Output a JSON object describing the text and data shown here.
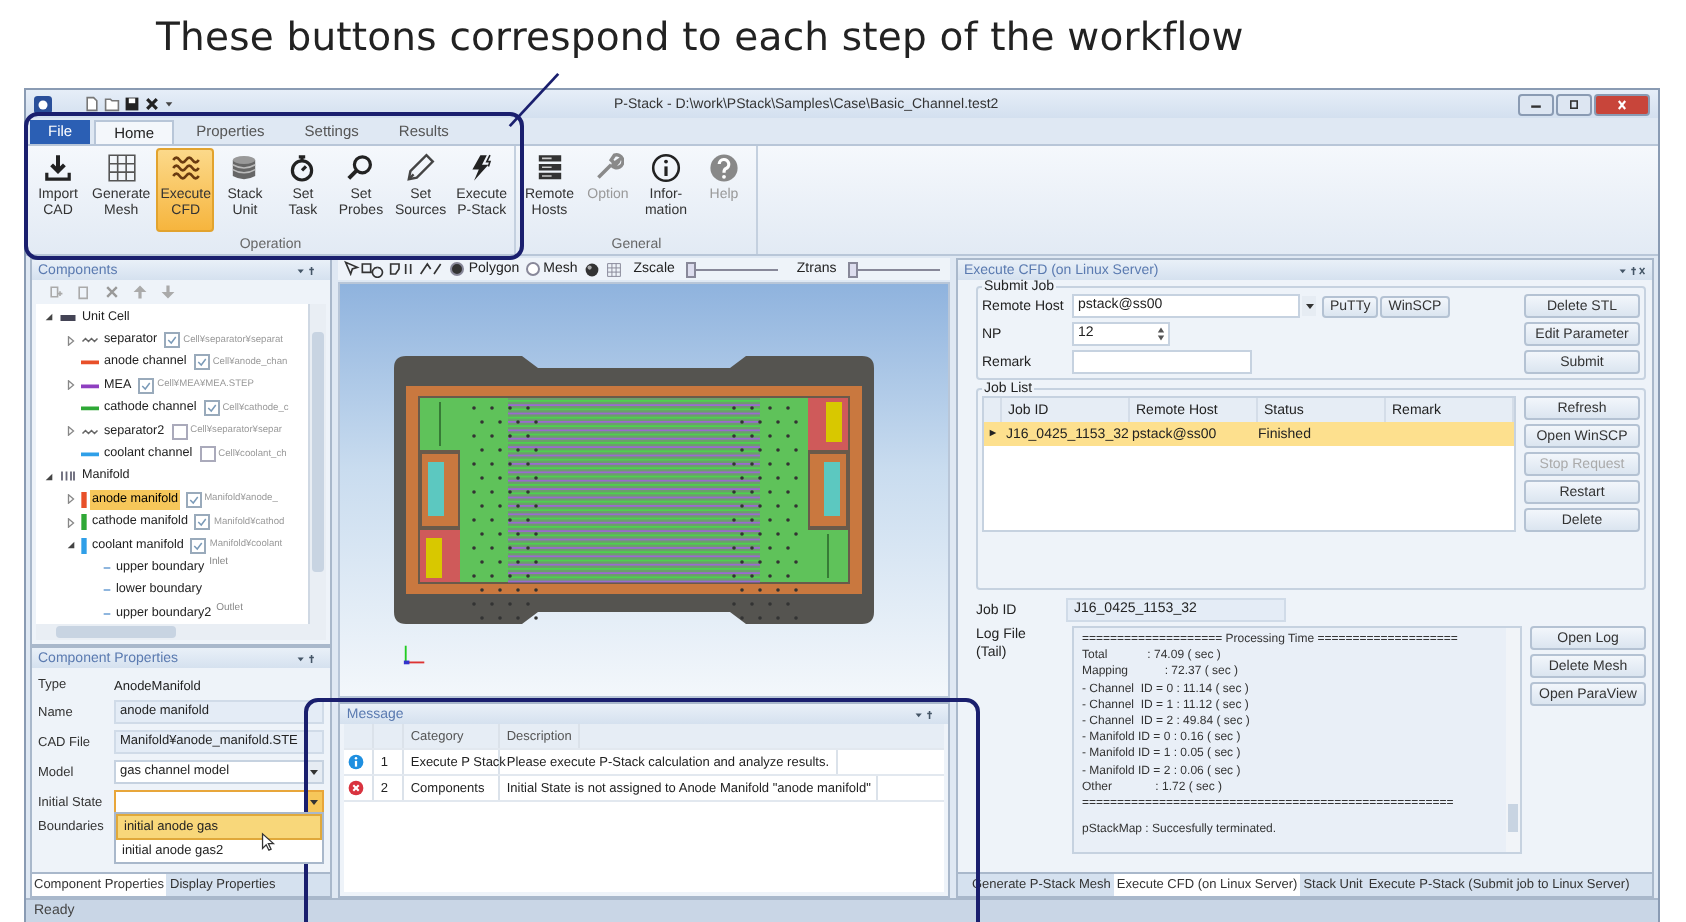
{
  "annotation": {
    "caption": "These buttons correspond to each step of the workflow"
  },
  "window": {
    "title": "P-Stack - D:\\work\\PStack\\Samples\\Case\\Basic_Channel.test2"
  },
  "ribbon": {
    "tabs": [
      {
        "label": "File",
        "kind": "file",
        "selected": false
      },
      {
        "label": "Home",
        "kind": "tab",
        "selected": true
      },
      {
        "label": "Properties",
        "kind": "tab",
        "selected": false
      },
      {
        "label": "Settings",
        "kind": "tab",
        "selected": false
      },
      {
        "label": "Results",
        "kind": "tab",
        "selected": false
      }
    ],
    "groups": [
      {
        "label": "Operation",
        "buttons": [
          {
            "label": "Import\nCAD",
            "kind": "import",
            "selected": false,
            "disabled": false
          },
          {
            "label": "Generate\nMesh",
            "kind": "grid",
            "selected": false,
            "disabled": false
          },
          {
            "label": "Execute\nCFD",
            "kind": "waves",
            "selected": true,
            "disabled": false
          },
          {
            "label": "Stack\nUnit",
            "kind": "stack",
            "selected": false,
            "disabled": false
          },
          {
            "label": "Set\nTask",
            "kind": "stopwatch",
            "selected": false,
            "disabled": false
          },
          {
            "label": "Set\nProbes",
            "kind": "magnifier",
            "selected": false,
            "disabled": false
          },
          {
            "label": "Set\nSources",
            "kind": "pen",
            "selected": false,
            "disabled": false
          },
          {
            "label": "Execute\nP-Stack",
            "kind": "lightning",
            "selected": false,
            "disabled": false
          }
        ]
      },
      {
        "label": "General",
        "buttons": [
          {
            "label": "Remote\nHosts",
            "kind": "server",
            "selected": false,
            "disabled": false
          },
          {
            "label": "Option",
            "kind": "wrench",
            "selected": false,
            "disabled": true
          },
          {
            "label": "Infor-\nmation",
            "kind": "info",
            "selected": false,
            "disabled": false
          },
          {
            "label": "Help",
            "kind": "help",
            "selected": false,
            "disabled": true
          }
        ]
      }
    ]
  },
  "components": {
    "title": "Components",
    "tree": [
      {
        "label": "Unit Cell",
        "kind": "cell-group",
        "expanded": true,
        "selected": false,
        "children": [
          {
            "label": "separator",
            "kind": "wave",
            "expanded": false,
            "checked": true,
            "file": "Cell¥separator¥separat",
            "selected": false
          },
          {
            "label": "anode channel",
            "kind": "line",
            "color": "#e8502a",
            "checked": true,
            "file": "Cell¥anode_chan",
            "selected": false
          },
          {
            "label": "MEA",
            "kind": "line",
            "color": "#8e3fc0",
            "expanded": false,
            "checked": true,
            "file": "Cell¥MEA¥MEA.STEP",
            "selected": false
          },
          {
            "label": "cathode channel",
            "kind": "line",
            "color": "#2fa836",
            "checked": true,
            "file": "Cell¥cathode_c",
            "selected": false
          },
          {
            "label": "separator2",
            "kind": "wave",
            "expanded": false,
            "checked": false,
            "file": "Cell¥separator¥separ",
            "selected": false
          },
          {
            "label": "coolant channel",
            "kind": "line",
            "color": "#2f9fe8",
            "checked": false,
            "file": "Cell¥coolant_ch",
            "selected": false
          }
        ]
      },
      {
        "label": "Manifold",
        "kind": "manifold-group",
        "expanded": true,
        "selected": false,
        "children": [
          {
            "label": "anode manifold",
            "kind": "bar",
            "color": "#e8502a",
            "expanded": false,
            "checked": true,
            "file": "Manifold¥anode_",
            "selected": true
          },
          {
            "label": "cathode manifold",
            "kind": "bar",
            "color": "#2fa836",
            "expanded": false,
            "checked": true,
            "file": "Manifold¥cathod",
            "selected": false
          },
          {
            "label": "coolant manifold",
            "kind": "bar",
            "color": "#2f9fe8",
            "expanded": true,
            "checked": true,
            "file": "Manifold¥coolant",
            "selected": false,
            "children": [
              {
                "label": "upper boundary",
                "kind": "boundary",
                "tag": "Inlet",
                "selected": false
              },
              {
                "label": "lower boundary",
                "kind": "boundary",
                "selected": false
              },
              {
                "label": "upper boundary2",
                "kind": "boundary",
                "tag": "Outlet",
                "selected": false
              }
            ]
          }
        ]
      }
    ]
  },
  "component_properties": {
    "title": "Component Properties",
    "fields": [
      {
        "label": "Type",
        "kind": "text",
        "value": "AnodeManifold"
      },
      {
        "label": "Name",
        "kind": "field",
        "value": "anode manifold"
      },
      {
        "label": "CAD File",
        "kind": "field",
        "value": "Manifold¥anode_manifold.STE"
      },
      {
        "label": "Model",
        "kind": "dropdown",
        "value": "gas channel model",
        "open": false
      },
      {
        "label": "Initial State",
        "kind": "dropdown",
        "open": true,
        "options": [
          {
            "label": "initial anode gas",
            "selected": true
          },
          {
            "label": "initial anode gas2",
            "selected": false
          }
        ]
      },
      {
        "label": "Boundaries",
        "kind": "text"
      }
    ],
    "tabs": [
      {
        "label": "Component Properties",
        "selected": true
      },
      {
        "label": "Display Properties",
        "selected": false
      }
    ]
  },
  "viewport": {
    "toolbar": {
      "modes": [
        {
          "label": "Polygon",
          "selected": true
        },
        {
          "label": "Mesh",
          "selected": false
        }
      ],
      "sliders": [
        {
          "label": "Zscale",
          "level": 0
        },
        {
          "label": "Ztrans",
          "level": 0
        }
      ]
    }
  },
  "messages": {
    "title": "Message",
    "columns": [
      "Category",
      "Description"
    ],
    "rows": [
      {
        "kind": "info",
        "number": "1",
        "category": "Execute P Stack",
        "description": "Please execute P-Stack calculation and analyze results."
      },
      {
        "kind": "error",
        "number": "2",
        "category": "Components",
        "description": "Initial State is not assigned to Anode Manifold \"anode manifold\""
      }
    ]
  },
  "cfd_panel": {
    "title": "Execute CFD (on Linux Server)",
    "submit_job": {
      "title": "Submit Job",
      "remote_host_label": "Remote Host",
      "remote_host": "pstack@ss00",
      "host_buttons": [
        "PuTTy",
        "WinSCP"
      ],
      "np_label": "NP",
      "np": "12",
      "remark_label": "Remark",
      "buttons": [
        {
          "label": "Delete STL",
          "disabled": false
        },
        {
          "label": "Edit Parameter",
          "disabled": false
        },
        {
          "label": "Submit",
          "disabled": false
        }
      ]
    },
    "job_list": {
      "title": "Job List",
      "columns": [
        "Job ID",
        "Remote Host",
        "Status",
        "Remark"
      ],
      "rows": [
        {
          "cells": [
            "J16_0425_1153_32",
            "pstack@ss00",
            "Finished"
          ],
          "selected": true
        }
      ],
      "buttons": [
        {
          "label": "Refresh",
          "disabled": false
        },
        {
          "label": "Open WinSCP",
          "disabled": false
        },
        {
          "label": "Stop Request",
          "disabled": true
        },
        {
          "label": "Restart",
          "disabled": false
        },
        {
          "label": "Delete",
          "disabled": false
        }
      ]
    },
    "job_id_label": "Job ID",
    "job_id": "J16_0425_1153_32",
    "log_label": "Log File\n(Tail)",
    "log_lines": [
      "==================== Processing Time ====================",
      "Total            : 74.09 ( sec )",
      "Mapping           : 72.37 ( sec )",
      "- Channel  ID = 0 : 11.14 ( sec )",
      "- Channel  ID = 1 : 11.12 ( sec )",
      "- Channel  ID = 2 : 49.84 ( sec )",
      "- Manifold ID = 0 : 0.16 ( sec )",
      "- Manifold ID = 1 : 0.05 ( sec )",
      "- Manifold ID = 2 : 0.06 ( sec )",
      "Other             : 1.72 ( sec )",
      "=====================================================",
      "pStackMap : Succesfully terminated."
    ],
    "log_buttons": [
      {
        "label": "Open Log",
        "disabled": false
      },
      {
        "label": "Delete Mesh",
        "disabled": false
      },
      {
        "label": "Open ParaView",
        "disabled": false
      }
    ]
  },
  "bottom_tabs": [
    {
      "label": "Generate P-Stack Mesh",
      "selected": false
    },
    {
      "label": "Execute CFD (on Linux Server)",
      "selected": true
    },
    {
      "label": "Stack Unit",
      "selected": false
    },
    {
      "label": "Execute P-Stack (Submit job to Linux Server)",
      "selected": false
    }
  ],
  "status_bar": {
    "text": "Ready"
  }
}
